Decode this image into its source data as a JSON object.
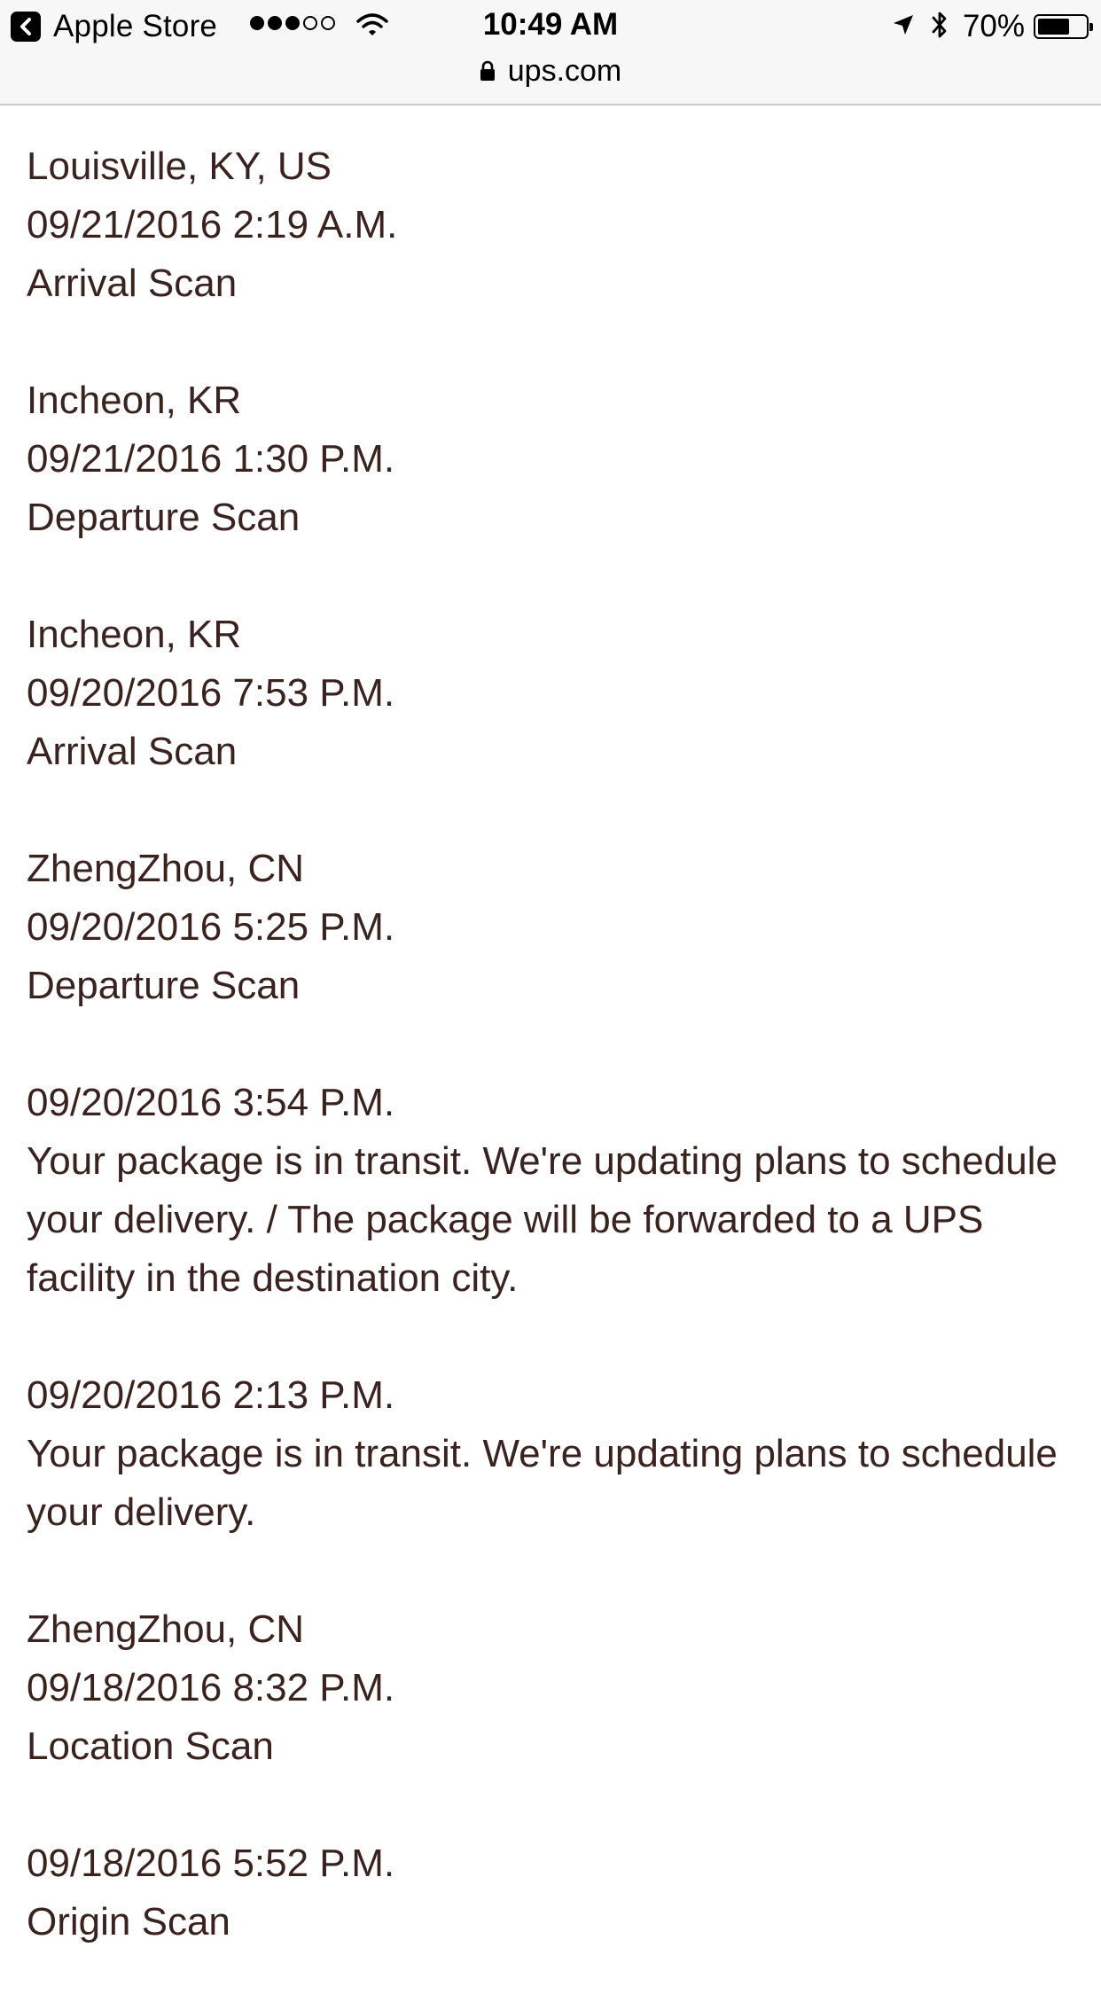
{
  "status_bar": {
    "back_app": "Apple Store",
    "signal_dots_filled": 3,
    "signal_dots_total": 5,
    "time": "10:49 AM",
    "battery_percent": "70%",
    "battery_level": 0.7,
    "icons": [
      "back-arrow-icon",
      "wifi-icon",
      "location-arrow-icon",
      "bluetooth-icon",
      "battery-icon"
    ]
  },
  "url_bar": {
    "domain": "ups.com",
    "icon": "lock-icon"
  },
  "events": [
    {
      "location": "Louisville, KY, US",
      "datetime": "09/21/2016 2:19 A.M.",
      "activity": "Arrival Scan"
    },
    {
      "location": "Incheon, KR",
      "datetime": "09/21/2016 1:30 P.M.",
      "activity": "Departure Scan"
    },
    {
      "location": "Incheon, KR",
      "datetime": "09/20/2016 7:53 P.M.",
      "activity": "Arrival Scan"
    },
    {
      "location": "ZhengZhou, CN",
      "datetime": "09/20/2016 5:25 P.M.",
      "activity": "Departure Scan"
    },
    {
      "location": "",
      "datetime": "09/20/2016 3:54 P.M.",
      "activity": "Your package is in transit. We're updating plans to schedule your delivery. / The package will be forwarded to a UPS facility in the destination city."
    },
    {
      "location": "",
      "datetime": "09/20/2016 2:13 P.M.",
      "activity": "Your package is in transit. We're updating plans to schedule your delivery."
    },
    {
      "location": "ZhengZhou, CN",
      "datetime": "09/18/2016 8:32 P.M.",
      "activity": "Location Scan"
    },
    {
      "location": "",
      "datetime": "09/18/2016 5:52 P.M.",
      "activity": "Origin Scan"
    }
  ]
}
